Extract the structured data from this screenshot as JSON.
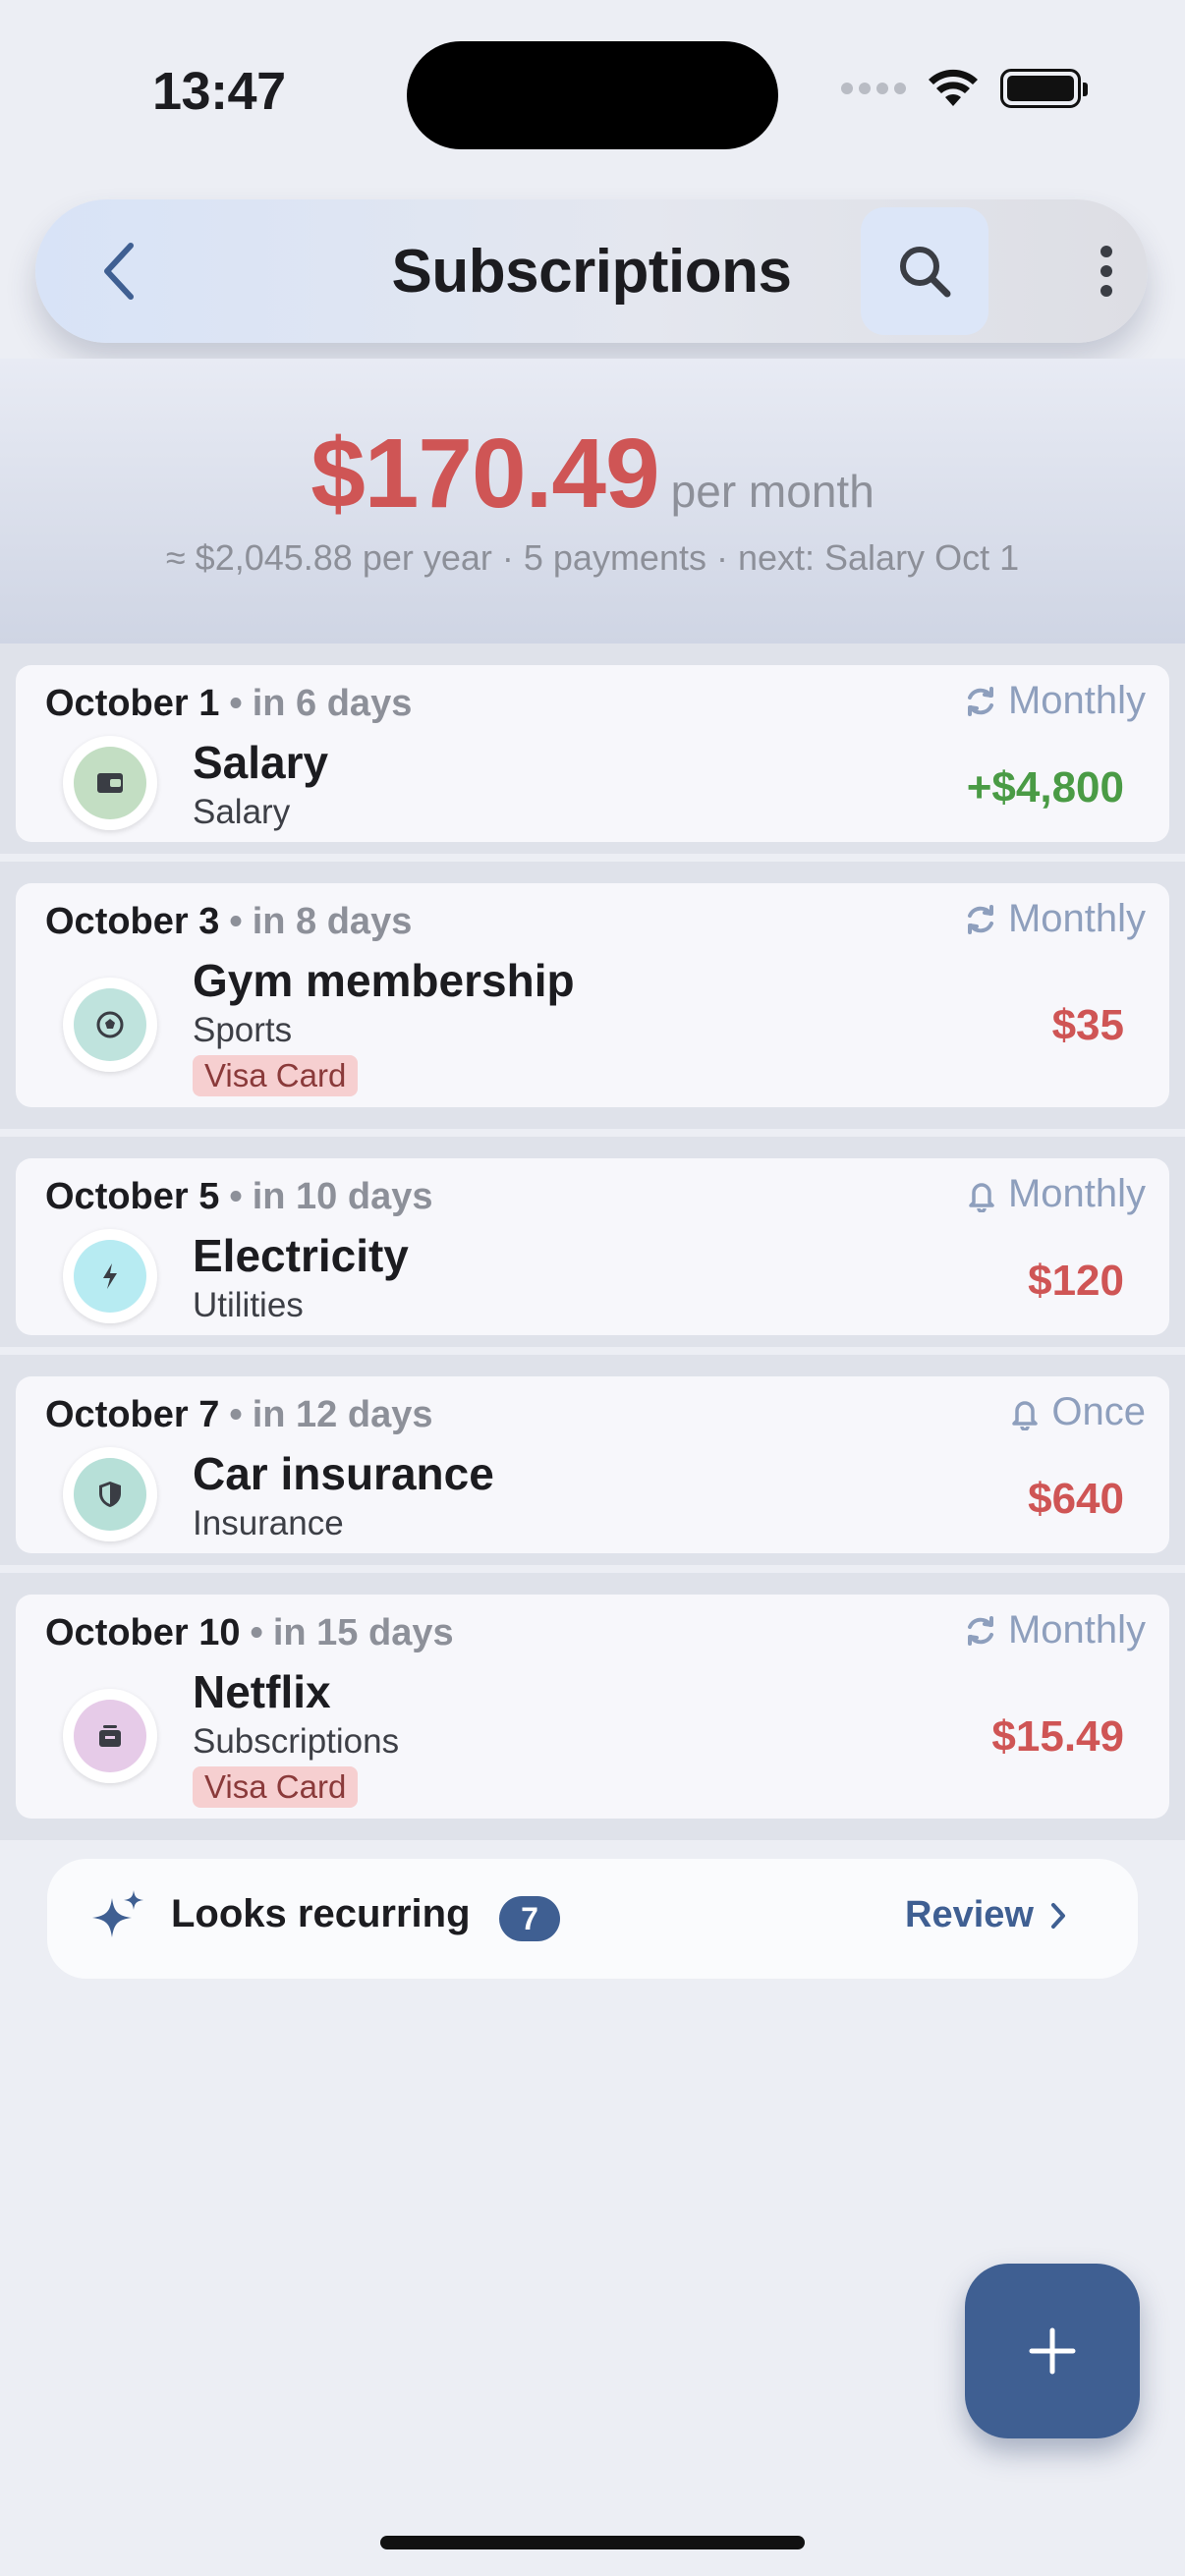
{
  "status_bar": {
    "time": "13:47"
  },
  "header": {
    "title": "Subscriptions"
  },
  "summary": {
    "amount": "$170.49",
    "period": "per month",
    "subline": "≈ $2,045.88 per year · 5 payments · next: Salary Oct 1"
  },
  "items": [
    {
      "date": "October 1",
      "relative": "in 6 days",
      "frequency": "Monthly",
      "frequency_icon": "repeat-icon",
      "name": "Salary",
      "category": "Salary",
      "tag": "",
      "amount": "+$4,800",
      "amount_type": "income",
      "icon": "wallet-icon",
      "icon_bg": "#c3dec3"
    },
    {
      "date": "October 3",
      "relative": "in 8 days",
      "frequency": "Monthly",
      "frequency_icon": "repeat-icon",
      "name": "Gym membership",
      "category": "Sports",
      "tag": "Visa Card",
      "amount": "$35",
      "amount_type": "expense",
      "icon": "soccer-ball-icon",
      "icon_bg": "#bfe3dd"
    },
    {
      "date": "October 5",
      "relative": "in 10 days",
      "frequency": "Monthly",
      "frequency_icon": "bell-icon",
      "name": "Electricity",
      "category": "Utilities",
      "tag": "",
      "amount": "$120",
      "amount_type": "expense",
      "icon": "lightning-icon",
      "icon_bg": "#b7ebf2"
    },
    {
      "date": "October 7",
      "relative": "in 12 days",
      "frequency": "Once",
      "frequency_icon": "bell-icon",
      "name": "Car insurance",
      "category": "Insurance",
      "tag": "",
      "amount": "$640",
      "amount_type": "expense",
      "icon": "shield-icon",
      "icon_bg": "#b7e0d8"
    },
    {
      "date": "October 10",
      "relative": "in 15 days",
      "frequency": "Monthly",
      "frequency_icon": "repeat-icon",
      "name": "Netflix",
      "category": "Subscriptions",
      "tag": "Visa Card",
      "amount": "$15.49",
      "amount_type": "expense",
      "icon": "media-icon",
      "icon_bg": "#e6cbe8"
    }
  ],
  "recurring": {
    "label": "Looks recurring",
    "count": "7",
    "action": "Review"
  },
  "colors": {
    "accent": "#3f5f92",
    "expense": "#cf5555",
    "income": "#4a9b45",
    "muted": "#8d9099"
  }
}
